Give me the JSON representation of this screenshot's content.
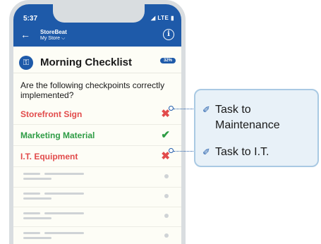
{
  "status_bar": {
    "time": "5:37",
    "indicators": "◢ LTE ▮"
  },
  "header": {
    "store_name": "StoreBeat",
    "store_selector": "My Store ⌵",
    "back_icon": "arrow-left-icon",
    "info_icon": "info-icon"
  },
  "checklist": {
    "title": "Morning Checklist",
    "progress_badge": "32%",
    "question": "Are the following checkpoints correctly implemented?",
    "items": [
      {
        "label": "Storefront Sign",
        "status": "fail",
        "mark": "✖",
        "color": "#e24b4b"
      },
      {
        "label": "Marketing Material",
        "status": "pass",
        "mark": "✔",
        "color": "#2e9c45"
      },
      {
        "label": "I.T. Equipment",
        "status": "fail",
        "mark": "✖",
        "color": "#e24b4b"
      }
    ]
  },
  "callout": {
    "tasks": [
      {
        "line1": "Task to",
        "line2": "Maintenance"
      },
      {
        "line1": "Task to I.T.",
        "line2": ""
      }
    ]
  },
  "colors": {
    "brand": "#1e5aa9",
    "fail": "#e24b4b",
    "pass": "#2e9c45",
    "callout_bg": "#e8f1f8"
  }
}
